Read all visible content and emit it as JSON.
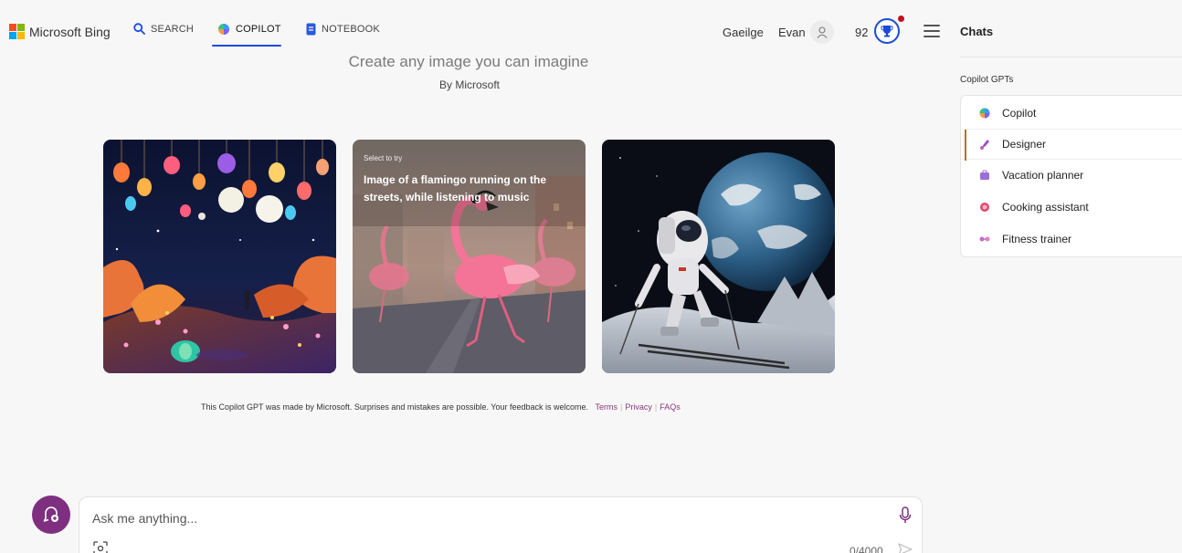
{
  "header": {
    "brand": "Microsoft Bing",
    "tabs": [
      {
        "label": "SEARCH",
        "icon": "search-icon"
      },
      {
        "label": "COPILOT",
        "icon": "copilot-icon",
        "active": true
      },
      {
        "label": "NOTEBOOK",
        "icon": "notebook-icon"
      }
    ],
    "language": "Gaeilge",
    "user_name": "Evan",
    "reward_points": "92",
    "accent_color": "#174ae4"
  },
  "main": {
    "title": "Create any image you can imagine",
    "subtitle": "By Microsoft",
    "cards": [
      {
        "description": "fantasy night landscape with lanterns"
      },
      {
        "tag": "Select to try",
        "prompt": "Image of a flamingo running on the streets, while listening to music"
      },
      {
        "description": "astronaut skiing on the moon"
      }
    ],
    "disclaimer": "This Copilot GPT was made by Microsoft. Surprises and mistakes are possible. Your feedback is welcome.",
    "links": {
      "terms": "Terms",
      "privacy": "Privacy",
      "faqs": "FAQs"
    }
  },
  "composer": {
    "placeholder": "Ask me anything...",
    "char_count": "0/4000",
    "new_topic_color": "#7e2f80"
  },
  "panel": {
    "title": "Chats",
    "section_label": "Copilot GPTs",
    "items": [
      {
        "label": "Copilot",
        "icon": "copilot-icon"
      },
      {
        "label": "Designer",
        "icon": "designer-icon",
        "active": true
      },
      {
        "label": "Vacation planner",
        "icon": "suitcase-icon"
      },
      {
        "label": "Cooking assistant",
        "icon": "cooking-icon"
      },
      {
        "label": "Fitness trainer",
        "icon": "dumbbell-icon"
      }
    ]
  }
}
